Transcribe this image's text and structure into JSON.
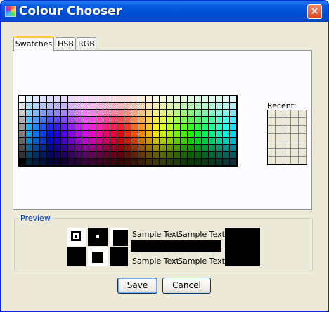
{
  "window": {
    "title": "Colour Chooser",
    "close_glyph": "✕"
  },
  "tabs": [
    {
      "label": "Swatches",
      "active": true
    },
    {
      "label": "HSB",
      "active": false
    },
    {
      "label": "RGB",
      "active": false
    }
  ],
  "recent": {
    "label": "Recent:"
  },
  "preview": {
    "title": "Preview",
    "sample_text": "Sample Text"
  },
  "buttons": {
    "save": "Save",
    "cancel": "Cancel"
  },
  "colors": {
    "title_bar": "#0050d8",
    "window_bg": "#ece9d8",
    "panel_bg": "#fcfcfe",
    "close_button": "#d9451e",
    "preview_title": "#0046d5",
    "preview_color": "#000000"
  },
  "icons": {
    "app": "colour-palette-icon",
    "close": "close-icon"
  }
}
